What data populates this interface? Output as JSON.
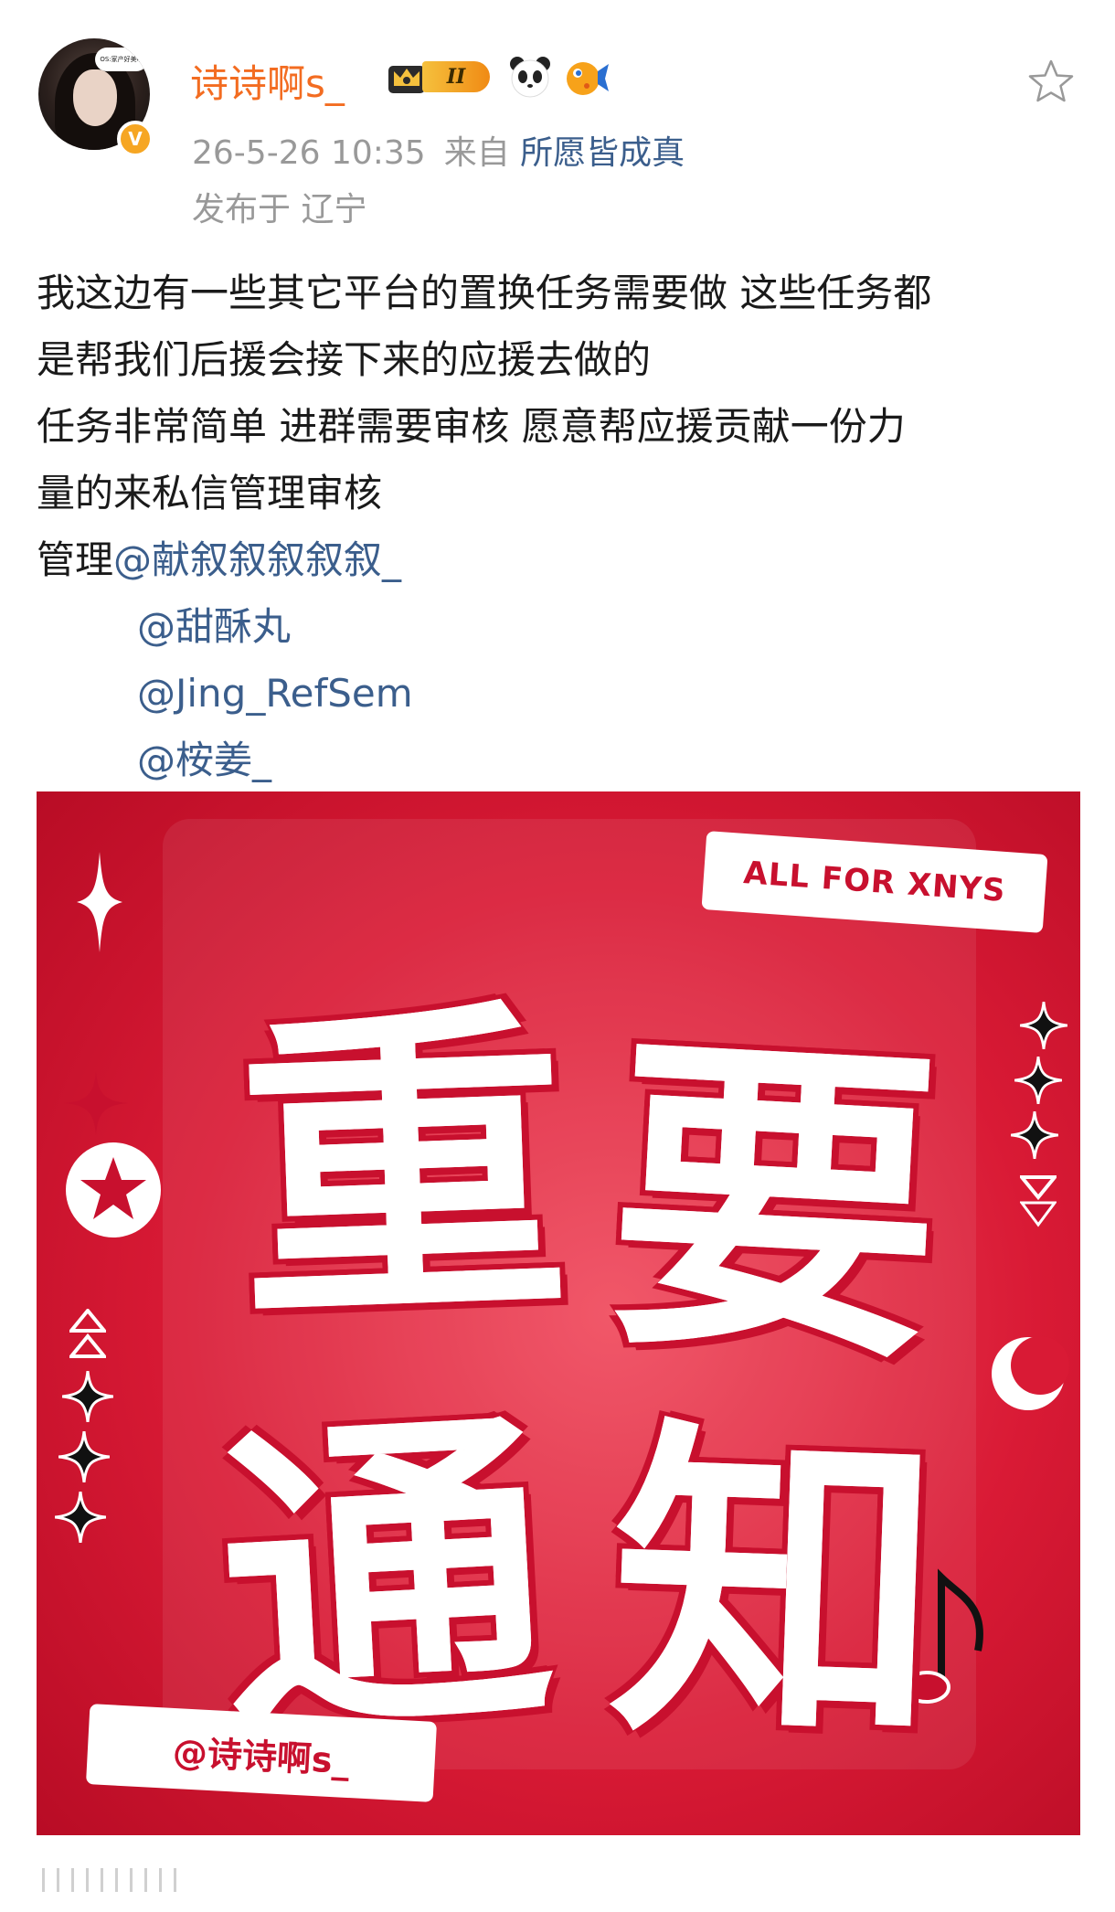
{
  "post": {
    "avatar_bubble_text": "OS:家产好美味",
    "username": "诗诗啊s_",
    "level_badge": "II",
    "timestamp": "26-5-26 10:35",
    "source_prefix": "来自",
    "source": "所愿皆成真",
    "location": "发布于 辽宁",
    "lines": [
      "我这边有一些其它平台的置换任务需要做 这些任务都",
      "是帮我们后援会接下来的应援去做的",
      "任务非常简单 进群需要审核 愿意帮应援贡献一份力",
      "量的来私信管理审核"
    ],
    "admin_prefix": "管理",
    "mentions": [
      "@献叙叙叙叙叙_",
      "@甜酥丸",
      "@Jing_RefSem",
      "@桉姜_"
    ]
  },
  "image": {
    "tag": "ALL FOR XNYS",
    "chars": [
      "重",
      "要",
      "通",
      "知"
    ],
    "handle": "@诗诗啊s_"
  },
  "colors": {
    "username": "#f36c21",
    "link": "#3b5e8c",
    "meta": "#999999",
    "poster_red": "#d91a35"
  }
}
